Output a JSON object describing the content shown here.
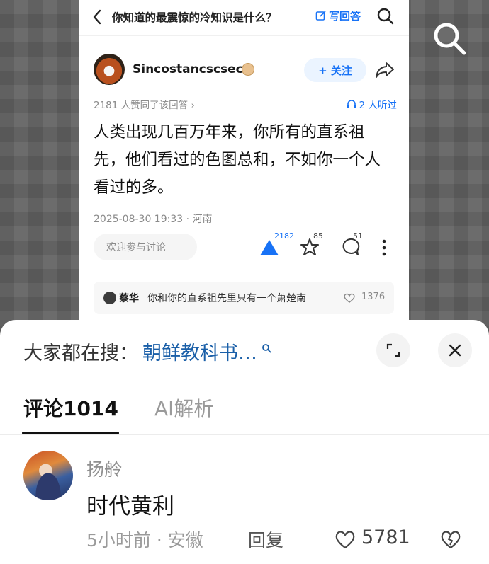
{
  "question": {
    "title": "你知道的最震惊的冷知识是什么？",
    "write_answer": "写回答"
  },
  "author": {
    "name": "Sincostancscsec",
    "follow_label": "+ 关注"
  },
  "meta": {
    "likes_text": "2181 人赞同了该回答 ›",
    "listen_text": "2 人听过"
  },
  "answer": {
    "body": "人类出现几百万年来，你所有的直系祖先，他们看过的色图总和，不如你一个人看过的多。",
    "post_meta": "2025-08-30 19:33 · 河南"
  },
  "actions": {
    "discuss_placeholder": "欢迎参与讨论",
    "vote_count": "2182",
    "star_count": "85",
    "comment_count": "51"
  },
  "hot_comment": {
    "name": "蔡华",
    "text": "你和你的直系祖先里只有一个萧楚南",
    "likes": "1376"
  },
  "sheet": {
    "trend_prefix": "大家都在搜：",
    "trend_keyword": "朝鲜教科书…",
    "tabs": [
      {
        "label": "评论1014"
      },
      {
        "label": "AI解析"
      }
    ]
  },
  "comment": {
    "name": "扬舲",
    "text": "时代黄利",
    "time_location": "5小时前 · 安徽",
    "reply_label": "回复",
    "likes": "5781"
  },
  "colors": {
    "accent": "#1772f6",
    "keyword": "#1a5fa8"
  }
}
